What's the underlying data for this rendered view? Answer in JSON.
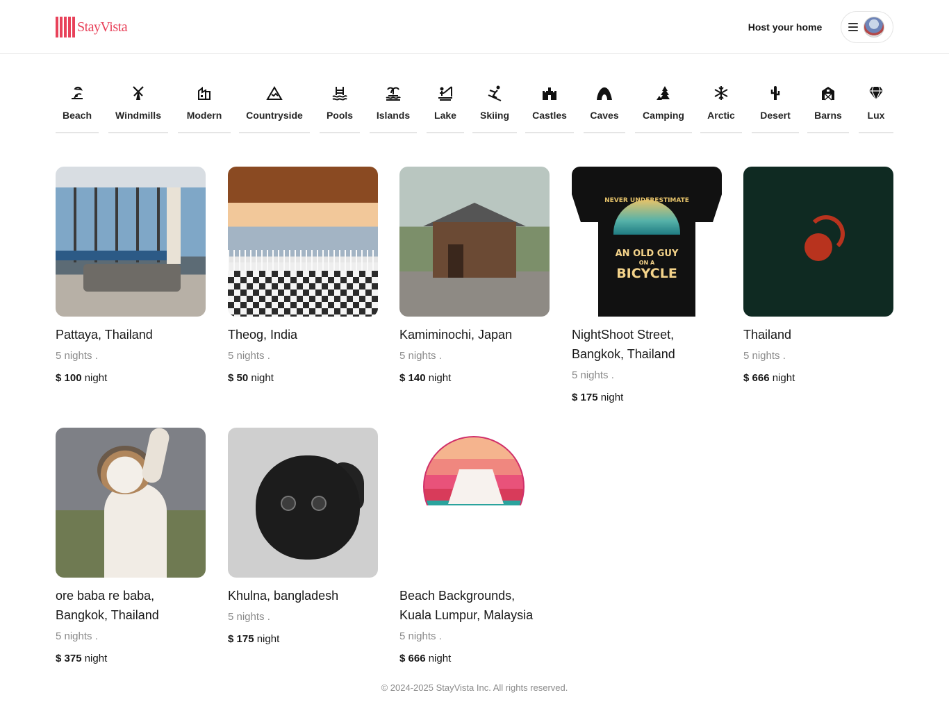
{
  "brand": {
    "name": "StayVista",
    "accent_color": "#e8425a"
  },
  "header": {
    "host_label": "Host your home",
    "menu_icon": "hamburger-menu-icon",
    "avatar_icon": "user-avatar"
  },
  "categories": [
    {
      "label": "Beach",
      "icon": "beach-icon"
    },
    {
      "label": "Windmills",
      "icon": "windmill-icon"
    },
    {
      "label": "Modern",
      "icon": "modern-building-icon"
    },
    {
      "label": "Countryside",
      "icon": "mountain-icon"
    },
    {
      "label": "Pools",
      "icon": "pool-icon"
    },
    {
      "label": "Islands",
      "icon": "island-icon"
    },
    {
      "label": "Lake",
      "icon": "lake-fishing-icon"
    },
    {
      "label": "Skiing",
      "icon": "skiing-icon"
    },
    {
      "label": "Castles",
      "icon": "castle-icon"
    },
    {
      "label": "Caves",
      "icon": "cave-icon"
    },
    {
      "label": "Camping",
      "icon": "camping-icon"
    },
    {
      "label": "Arctic",
      "icon": "snowflake-icon"
    },
    {
      "label": "Desert",
      "icon": "cactus-icon"
    },
    {
      "label": "Barns",
      "icon": "barn-icon"
    },
    {
      "label": "Lux",
      "icon": "diamond-icon"
    }
  ],
  "listings": [
    {
      "title": "Pattaya, Thailand",
      "nights": "5 nights .",
      "price": "$ 100",
      "unit": "night"
    },
    {
      "title": "Theog, India",
      "nights": "5 nights .",
      "price": "$ 50",
      "unit": "night"
    },
    {
      "title": "Kamiminochi, Japan",
      "nights": "5 nights .",
      "price": "$ 140",
      "unit": "night"
    },
    {
      "title": "NightShoot Street, Bangkok, Thailand",
      "nights": "5 nights .",
      "price": "$ 175",
      "unit": "night"
    },
    {
      "title": "Thailand",
      "nights": "5 nights .",
      "price": "$ 666",
      "unit": "night"
    },
    {
      "title": "ore baba re baba, Bangkok, Thailand",
      "nights": "5 nights .",
      "price": "$ 375",
      "unit": "night"
    },
    {
      "title": "Khulna, bangladesh",
      "nights": "5 nights .",
      "price": "$ 175",
      "unit": "night"
    },
    {
      "title": "Beach Backgrounds, Kuala Lumpur, Malaysia",
      "nights": "5 nights .",
      "price": "$ 666",
      "unit": "night"
    }
  ],
  "shirt_art": {
    "line1": "NEVER UNDERESTIMATE",
    "line2": "AN OLD GUY",
    "line3": "ON A",
    "line4": "BICYCLE"
  },
  "footer": {
    "text": "© 2024-2025 StayVista Inc. All rights reserved."
  }
}
